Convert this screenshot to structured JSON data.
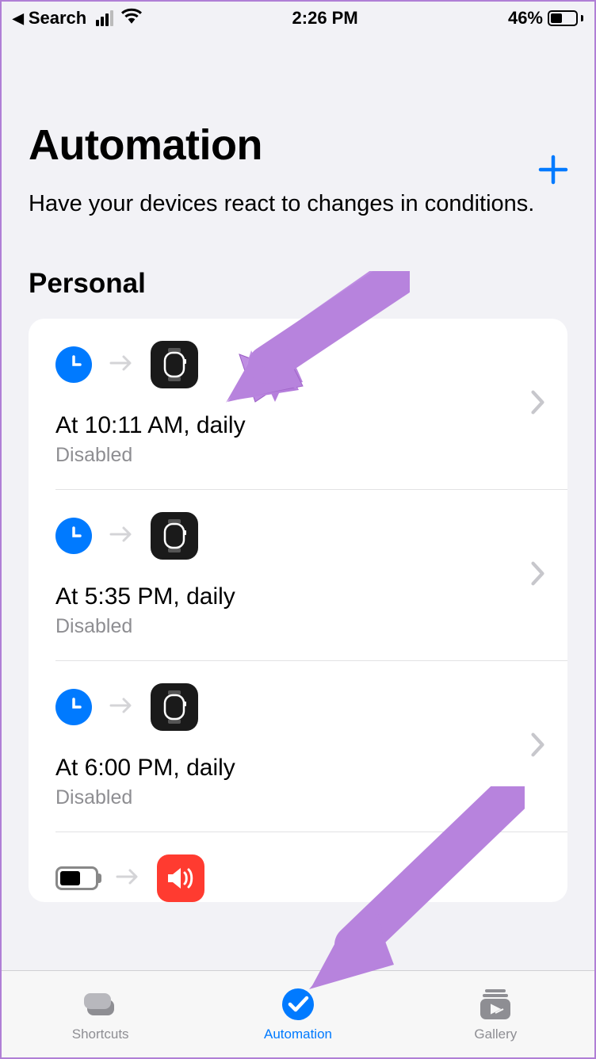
{
  "status": {
    "back_label": "Search",
    "time": "2:26 PM",
    "battery_percent": "46%"
  },
  "header": {
    "title": "Automation",
    "subtitle": "Have your devices react to changes in conditions."
  },
  "section": {
    "title": "Personal"
  },
  "automations": [
    {
      "title": "At 10:11 AM, daily",
      "status": "Disabled",
      "trigger": "clock",
      "action": "watch"
    },
    {
      "title": "At 5:35 PM, daily",
      "status": "Disabled",
      "trigger": "clock",
      "action": "watch"
    },
    {
      "title": "At 6:00 PM, daily",
      "status": "Disabled",
      "trigger": "clock",
      "action": "watch"
    },
    {
      "title": "",
      "status": "",
      "trigger": "battery",
      "action": "sound"
    }
  ],
  "tabs": {
    "shortcuts": "Shortcuts",
    "automation": "Automation",
    "gallery": "Gallery"
  }
}
